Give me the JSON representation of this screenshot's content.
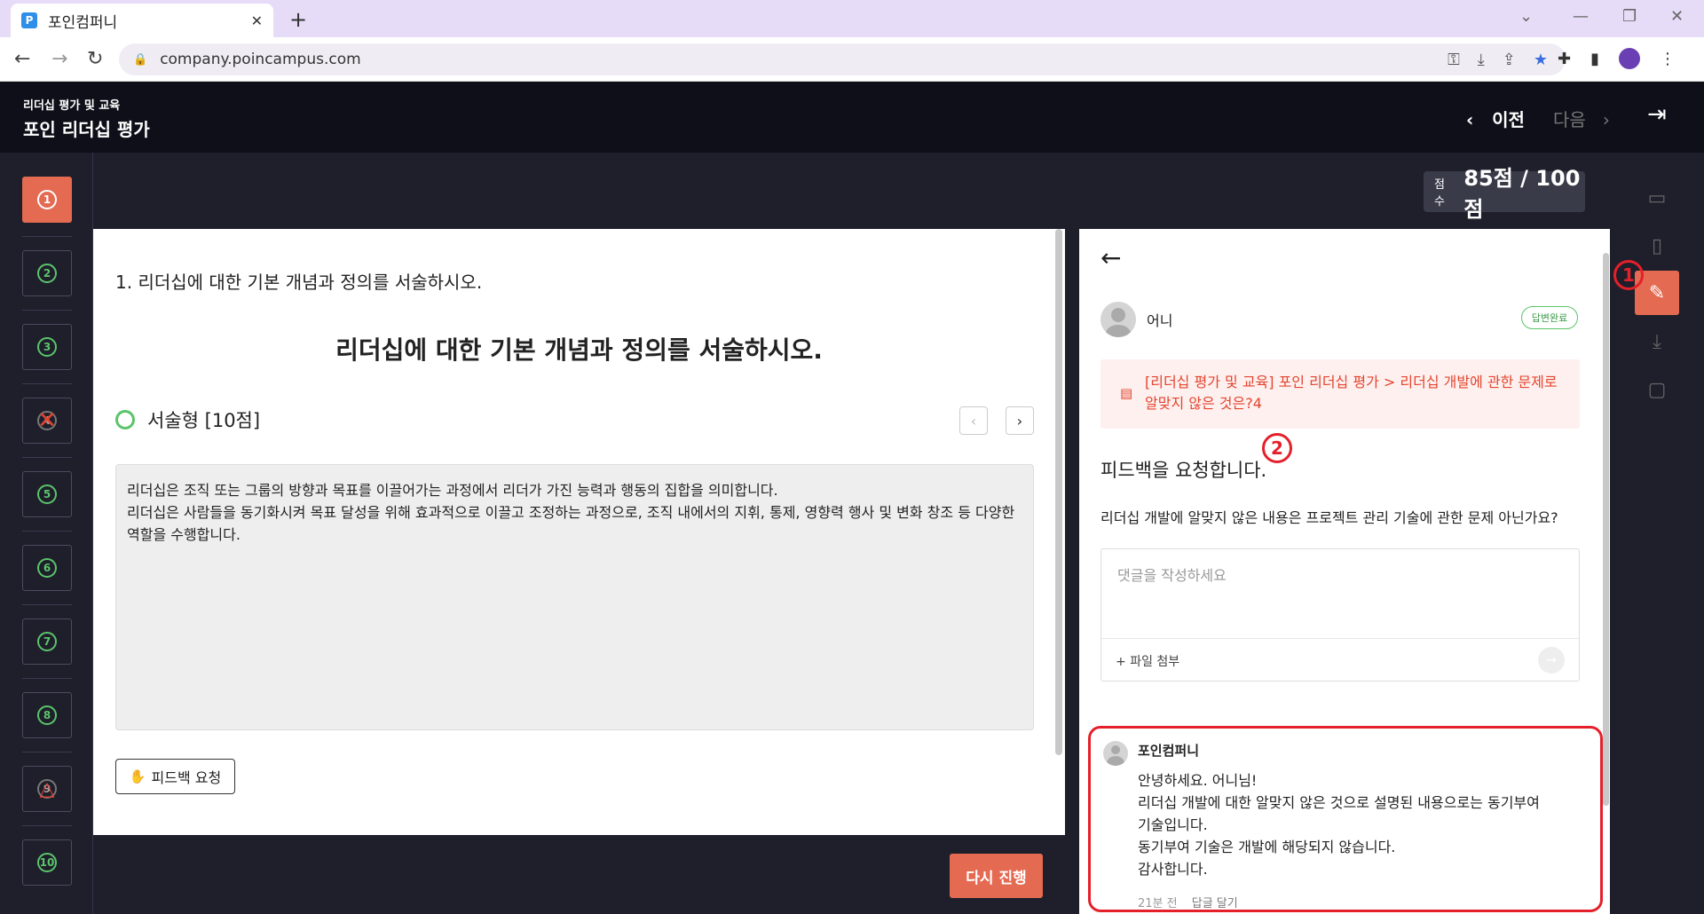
{
  "browser": {
    "tab_title": "포인컴퍼니",
    "favicon": "P",
    "url": "company.poincampus.com"
  },
  "header": {
    "subtitle": "리더십 평가 및 교육",
    "title": "포인 리더십 평가",
    "prev_label": "이전",
    "next_label": "다음"
  },
  "score": {
    "label": "점수",
    "value": "85점 / 100점"
  },
  "questions": [
    {
      "num": "1",
      "state": "active"
    },
    {
      "num": "2",
      "state": "correct"
    },
    {
      "num": "3",
      "state": "correct"
    },
    {
      "num": "4",
      "state": "wrong"
    },
    {
      "num": "5",
      "state": "correct"
    },
    {
      "num": "6",
      "state": "correct"
    },
    {
      "num": "7",
      "state": "correct"
    },
    {
      "num": "8",
      "state": "correct"
    },
    {
      "num": "9",
      "state": "partial"
    },
    {
      "num": "10",
      "state": "correct"
    }
  ],
  "question": {
    "heading": "1. 리더십에 대한 기본 개념과 정의를 서술하시오.",
    "big_title": "리더십에 대한 기본 개념과 정의를 서술하시오.",
    "type": "서술형 [10점]",
    "answer_line1": "리더십은 조직 또는 그룹의 방향과 목표를 이끌어가는 과정에서 리더가 가진 능력과 행동의 집합을 의미합니다.",
    "answer_line2": "리더십은 사람들을 동기화시켜 목표 달성을 위해 효과적으로 이끌고 조정하는 과정으로, 조직 내에서의 지휘, 통제, 영향력 행사 및 변화 창조 등 다양한 역할을 수행합니다.",
    "feedback_button": "피드백 요청",
    "retry_button": "다시 진행"
  },
  "feedback": {
    "user_name": "어니",
    "status": "답변완료",
    "reference": "[리더십 평가 및 교육] 포인 리더십 평가 > 리더십 개발에 관한 문제로 알맞지 않은 것은?4",
    "title": "피드백을 요청합니다.",
    "body": "리더십 개발에 알맞지 않은 내용은 프로젝트 관리 기술에 관한 문제 아닌가요?",
    "comment_placeholder": "댓글을 작성하세요",
    "attach_label": "파일 첨부",
    "reply": {
      "author": "포인컴퍼니",
      "line1": "안녕하세요. 어니님!",
      "line2": "리더십 개발에 대한 알맞지 않은 것으로 설명된 내용으로는 동기부여",
      "line3": "기술입니다.",
      "line4": "동기부여 기술은 개발에 해당되지 않습니다.",
      "line5": "감사합니다.",
      "time": "21분 전",
      "action": "답글 달기"
    }
  },
  "markers": {
    "m1": "1",
    "m2": "2"
  },
  "right_sidebar": [
    "monitor-icon",
    "book-icon",
    "feedback-icon",
    "download-icon",
    "chat-icon"
  ],
  "colors": {
    "accent": "#e46a52",
    "correct": "#5bc46a",
    "wrong": "#e4442f",
    "dark": "#0f0f1a"
  }
}
